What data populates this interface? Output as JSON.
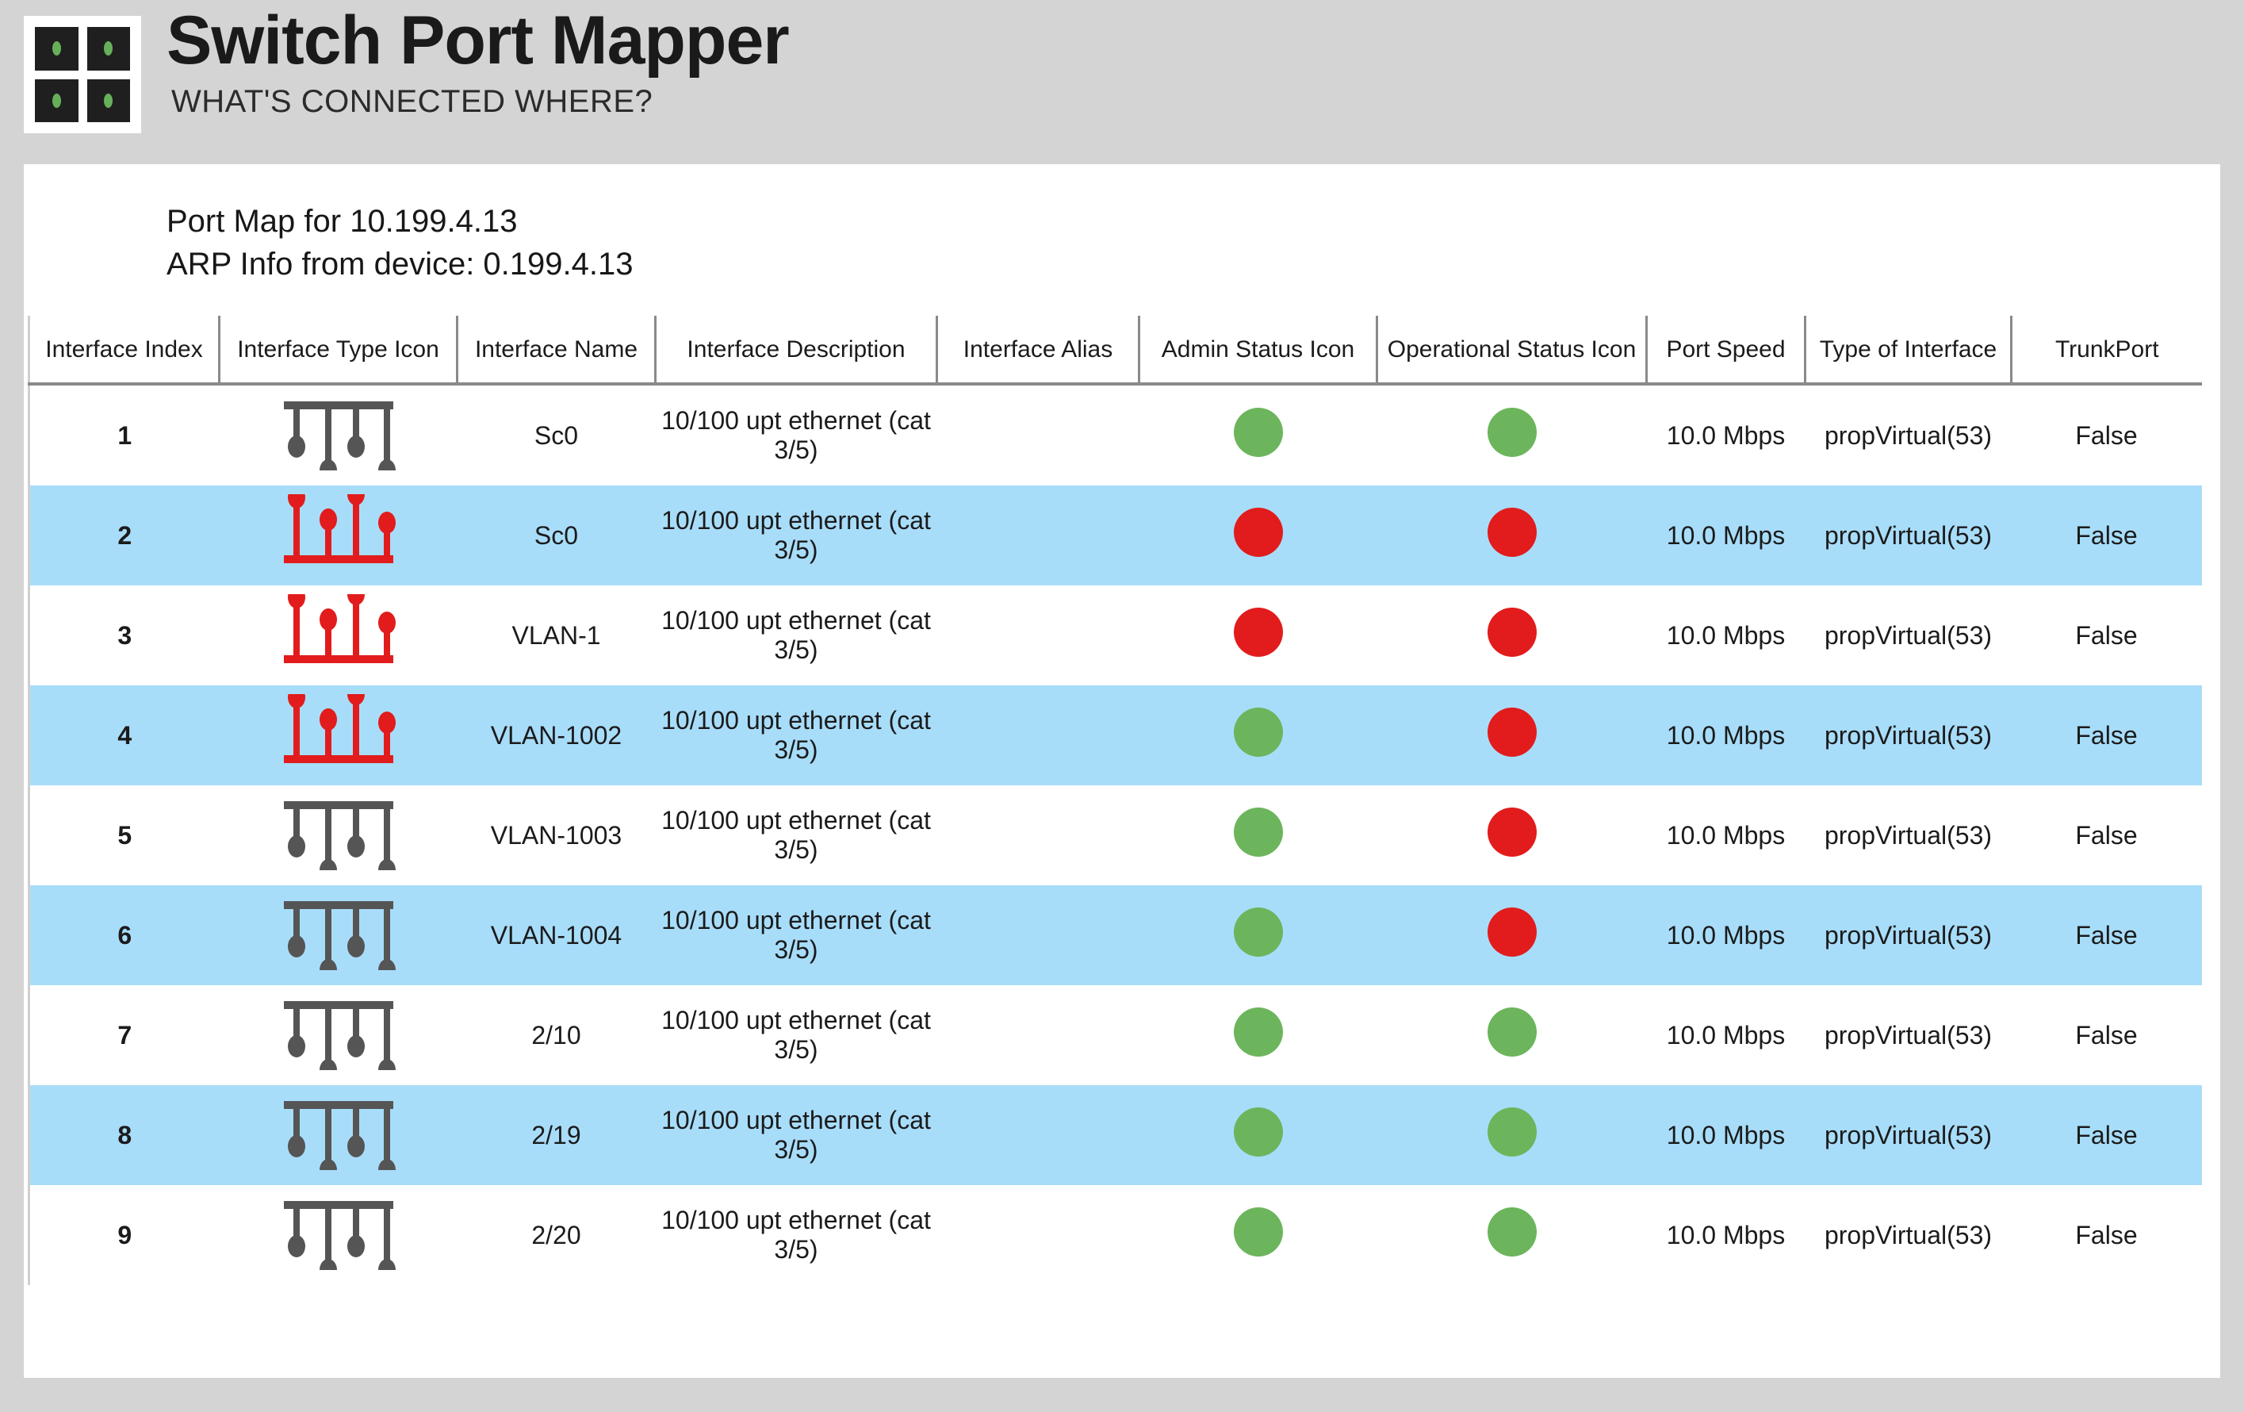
{
  "branding": {
    "title": "Switch Port Mapper",
    "subtitle": "WHAT'S CONNECTED WHERE?",
    "logo_led_color": "#66b05a",
    "logo_port_color": "#1f1f1f"
  },
  "report": {
    "port_map_line": "Port Map for 10.199.4.13",
    "arp_line": "ARP Info from device: 0.199.4.13"
  },
  "colors": {
    "page_background": "#d4d4d4",
    "card_background": "#ffffff",
    "row_alt_background": "#a8ddfa",
    "status_up": "#6cb55c",
    "status_down": "#e21c1c",
    "icon_gray": "#555555",
    "icon_red": "#e21c1c",
    "rule_gray": "#8a8a8a"
  },
  "table": {
    "headers": [
      "Interface Index",
      "Interface Type Icon",
      "Interface Name",
      "Interface Description",
      "Interface Alias",
      "Admin Status Icon",
      "Operational Status Icon",
      "Port Speed",
      "Type of Interface",
      "TrunkPort"
    ],
    "rows": [
      {
        "index": "1",
        "icon": {
          "name": "bus-topology-icon",
          "variant": "down",
          "color": "#555555"
        },
        "name": "Sc0",
        "description": "10/100 upt ethernet (cat 3/5)",
        "alias": "",
        "admin_status": "up",
        "operational_status": "up",
        "port_speed": "10.0 Mbps",
        "type_of_interface": "propVirtual(53)",
        "trunk_port": "False"
      },
      {
        "index": "2",
        "icon": {
          "name": "bus-topology-icon",
          "variant": "up",
          "color": "#e21c1c"
        },
        "name": "Sc0",
        "description": "10/100 upt ethernet (cat 3/5)",
        "alias": "",
        "admin_status": "down",
        "operational_status": "down",
        "port_speed": "10.0 Mbps",
        "type_of_interface": "propVirtual(53)",
        "trunk_port": "False"
      },
      {
        "index": "3",
        "icon": {
          "name": "bus-topology-icon",
          "variant": "up",
          "color": "#e21c1c"
        },
        "name": "VLAN-1",
        "description": "10/100 upt ethernet (cat 3/5)",
        "alias": "",
        "admin_status": "down",
        "operational_status": "down",
        "port_speed": "10.0 Mbps",
        "type_of_interface": "propVirtual(53)",
        "trunk_port": "False"
      },
      {
        "index": "4",
        "icon": {
          "name": "bus-topology-icon",
          "variant": "up",
          "color": "#e21c1c"
        },
        "name": "VLAN-1002",
        "description": "10/100 upt ethernet (cat 3/5)",
        "alias": "",
        "admin_status": "up",
        "operational_status": "down",
        "port_speed": "10.0 Mbps",
        "type_of_interface": "propVirtual(53)",
        "trunk_port": "False"
      },
      {
        "index": "5",
        "icon": {
          "name": "bus-topology-icon",
          "variant": "down",
          "color": "#555555"
        },
        "name": "VLAN-1003",
        "description": "10/100 upt ethernet (cat 3/5)",
        "alias": "",
        "admin_status": "up",
        "operational_status": "down",
        "port_speed": "10.0 Mbps",
        "type_of_interface": "propVirtual(53)",
        "trunk_port": "False"
      },
      {
        "index": "6",
        "icon": {
          "name": "bus-topology-icon",
          "variant": "down",
          "color": "#555555"
        },
        "name": "VLAN-1004",
        "description": "10/100 upt ethernet (cat 3/5)",
        "alias": "",
        "admin_status": "up",
        "operational_status": "down",
        "port_speed": "10.0 Mbps",
        "type_of_interface": "propVirtual(53)",
        "trunk_port": "False"
      },
      {
        "index": "7",
        "icon": {
          "name": "bus-topology-icon",
          "variant": "down",
          "color": "#555555"
        },
        "name": "2/10",
        "description": "10/100 upt ethernet (cat 3/5)",
        "alias": "",
        "admin_status": "up",
        "operational_status": "up",
        "port_speed": "10.0 Mbps",
        "type_of_interface": "propVirtual(53)",
        "trunk_port": "False"
      },
      {
        "index": "8",
        "icon": {
          "name": "bus-topology-icon",
          "variant": "down",
          "color": "#555555"
        },
        "name": "2/19",
        "description": "10/100 upt ethernet (cat 3/5)",
        "alias": "",
        "admin_status": "up",
        "operational_status": "up",
        "port_speed": "10.0 Mbps",
        "type_of_interface": "propVirtual(53)",
        "trunk_port": "False"
      },
      {
        "index": "9",
        "icon": {
          "name": "bus-topology-icon",
          "variant": "down",
          "color": "#555555"
        },
        "name": "2/20",
        "description": "10/100 upt ethernet (cat 3/5)",
        "alias": "",
        "admin_status": "up",
        "operational_status": "up",
        "port_speed": "10.0 Mbps",
        "type_of_interface": "propVirtual(53)",
        "trunk_port": "False"
      }
    ]
  }
}
